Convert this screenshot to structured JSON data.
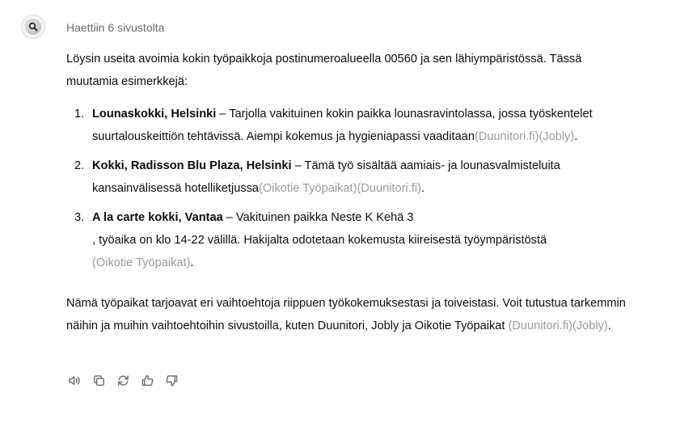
{
  "status": "Haettiin 6 sivustolta",
  "intro": "Löysin useita avoimia kokin työpaikkoja postinumeroalueella 00560 ja sen lähiympäristössä. Tässä muutamia esimerkkejä:",
  "jobs": [
    {
      "num": "1.",
      "title": "Lounaskokki, Helsinki",
      "desc": " – Tarjolla vakituinen kokin paikka lounasravintolassa, jossa työskentelet suurtalouskeittiön tehtävissä. Aiempi kokemus ja hygieniapassi vaaditaan",
      "sources": [
        "(Duunitori.fi)",
        "(Jobly)"
      ],
      "end": "."
    },
    {
      "num": "2.",
      "title": "Kokki, Radisson Blu Plaza, Helsinki",
      "desc": " – Tämä työ sisältää aamiais- ja lounasvalmisteluita kansainvälisessä hotelliketjussa",
      "sources": [
        "(Oikotie Työpaikat)",
        "(Duunitori.fi)"
      ],
      "end": "."
    },
    {
      "num": "3.",
      "title": "A la carte kokki, Vantaa",
      "desc": " – Vakituinen paikka Neste K Kehä 3",
      "desc2": ", työaika on klo 14-22 välillä. Hakijalta odotetaan kokemusta kiireisestä työympäristöstä",
      "sources": [
        "(Oikotie Työpaikat)"
      ],
      "end": "."
    }
  ],
  "outro": "Nämä työpaikat tarjoavat eri vaihtoehtoja riippuen työkokemuksestasi ja toiveistasi. Voit tutustua tarkemmin näihin ja muihin vaihtoehtoihin sivustoilla, kuten Duunitori, Jobly ja Oikotie Työpaikat",
  "outro_sources": [
    "(Duunitori.fi)",
    "(Jobly)"
  ],
  "outro_end": ".",
  "actions": {
    "read_aloud": "speaker-icon",
    "copy": "copy-icon",
    "regenerate": "refresh-icon",
    "thumbs_up": "thumbs-up-icon",
    "thumbs_down": "thumbs-down-icon"
  }
}
